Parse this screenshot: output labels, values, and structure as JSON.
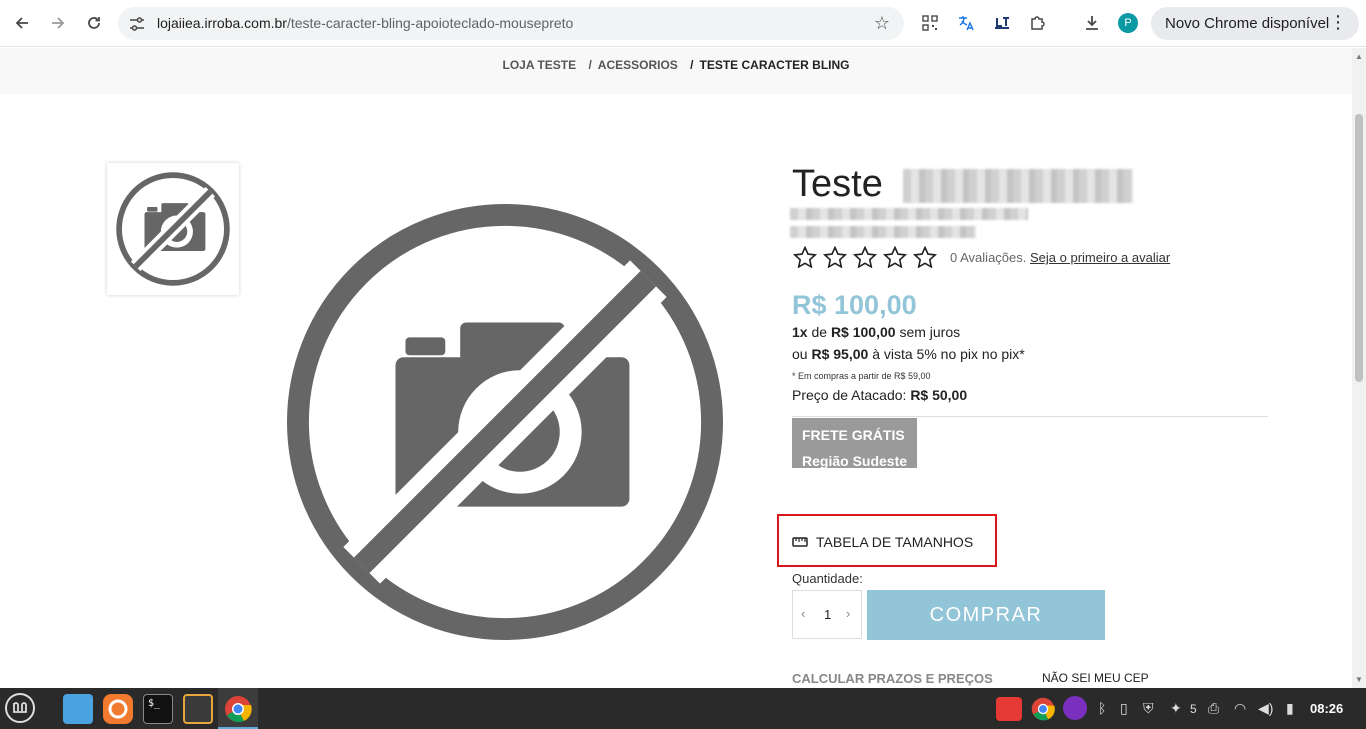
{
  "browser": {
    "url_host": "lojaiiea.irroba.com.br",
    "url_path": "/teste-caracter-bling-apoioteclado-mousepreto",
    "profile_initial": "P",
    "update_label": "Novo Chrome disponível"
  },
  "breadcrumb": {
    "items": [
      "LOJA TESTE",
      "ACESSORIOS",
      "TESTE CARACTER BLING"
    ],
    "separator": "/"
  },
  "product": {
    "title_visible": "Teste",
    "rating_count_text": "0 Avaliações.",
    "rating_stars": 0,
    "rating_max": 5,
    "first_review_link": "Seja o primeiro a avaliar",
    "price": "R$ 100,00",
    "installments_count": "1x",
    "installments_of": "de",
    "installments_value": "R$ 100,00",
    "installments_suffix": "sem juros",
    "pix_prefix": "ou",
    "pix_value": "R$ 95,00",
    "pix_suffix": "à vista 5% no pix no pix*",
    "pix_note": "* Em compras a partir de R$ 59,00",
    "wholesale_label": "Preço de Atacado:",
    "wholesale_value": "R$ 50,00",
    "shipping_line1": "FRETE GRÁTIS",
    "shipping_line2": "Região Sudeste",
    "size_table_label": "TABELA DE TAMANHOS",
    "quantity_label": "Quantidade:",
    "quantity_value": "1",
    "buy_label": "COMPRAR",
    "calc_label": "CALCULAR PRAZOS E PREÇOS",
    "no_cep_label": "NÃO SEI MEU CEP"
  },
  "colors": {
    "accent": "#93c5d8",
    "highlight_box": "#d9161a",
    "shipping_badge": "#9a9a9a"
  },
  "taskbar": {
    "tray_count": "5",
    "clock": "08:26"
  }
}
